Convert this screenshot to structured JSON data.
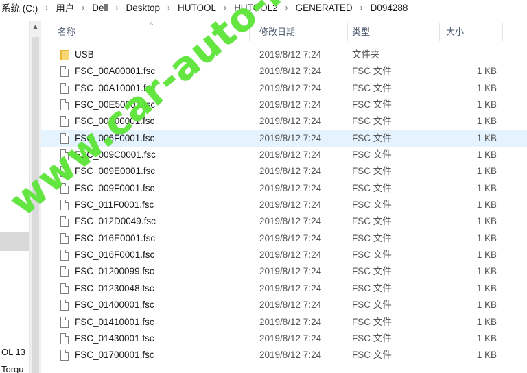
{
  "breadcrumb": {
    "items": [
      "系统 (C:)",
      "用户",
      "Dell",
      "Desktop",
      "HUTOOL",
      "HUTOOL2",
      "GENERATED",
      "D094288"
    ],
    "separator": "›"
  },
  "nav_pane": {
    "items": [
      {
        "label": "OL 13"
      },
      {
        "label": "Torqu"
      }
    ]
  },
  "columns": {
    "name": "名称",
    "date": "修改日期",
    "type": "类型",
    "size": "大小",
    "sort_indicator": "^"
  },
  "files": [
    {
      "name": "USB",
      "date": "2019/8/12 7:24",
      "type": "文件夹",
      "size": "",
      "icon": "folder-icon",
      "selected": false
    },
    {
      "name": "FSC_00A00001.fsc",
      "date": "2019/8/12 7:24",
      "type": "FSC 文件",
      "size": "1 KB",
      "icon": "file-icon",
      "selected": false
    },
    {
      "name": "FSC_00A10001.fsc",
      "date": "2019/8/12 7:24",
      "type": "FSC 文件",
      "size": "1 KB",
      "icon": "file-icon",
      "selected": false
    },
    {
      "name": "FSC_00E50001.fsc",
      "date": "2019/8/12 7:24",
      "type": "FSC 文件",
      "size": "1 KB",
      "icon": "file-icon",
      "selected": false
    },
    {
      "name": "FSC_00F00001.fsc",
      "date": "2019/8/12 7:24",
      "type": "FSC 文件",
      "size": "1 KB",
      "icon": "file-icon",
      "selected": false
    },
    {
      "name": "FSC_006F0001.fsc",
      "date": "2019/8/12 7:24",
      "type": "FSC 文件",
      "size": "1 KB",
      "icon": "file-icon",
      "selected": true
    },
    {
      "name": "FSC_009C0001.fsc",
      "date": "2019/8/12 7:24",
      "type": "FSC 文件",
      "size": "1 KB",
      "icon": "file-icon",
      "selected": false
    },
    {
      "name": "FSC_009E0001.fsc",
      "date": "2019/8/12 7:24",
      "type": "FSC 文件",
      "size": "1 KB",
      "icon": "file-icon",
      "selected": false
    },
    {
      "name": "FSC_009F0001.fsc",
      "date": "2019/8/12 7:24",
      "type": "FSC 文件",
      "size": "1 KB",
      "icon": "file-icon",
      "selected": false
    },
    {
      "name": "FSC_011F0001.fsc",
      "date": "2019/8/12 7:24",
      "type": "FSC 文件",
      "size": "1 KB",
      "icon": "file-icon",
      "selected": false
    },
    {
      "name": "FSC_012D0049.fsc",
      "date": "2019/8/12 7:24",
      "type": "FSC 文件",
      "size": "1 KB",
      "icon": "file-icon",
      "selected": false
    },
    {
      "name": "FSC_016E0001.fsc",
      "date": "2019/8/12 7:24",
      "type": "FSC 文件",
      "size": "1 KB",
      "icon": "file-icon",
      "selected": false
    },
    {
      "name": "FSC_016F0001.fsc",
      "date": "2019/8/12 7:24",
      "type": "FSC 文件",
      "size": "1 KB",
      "icon": "file-icon",
      "selected": false
    },
    {
      "name": "FSC_01200099.fsc",
      "date": "2019/8/12 7:24",
      "type": "FSC 文件",
      "size": "1 KB",
      "icon": "file-icon",
      "selected": false
    },
    {
      "name": "FSC_01230048.fsc",
      "date": "2019/8/12 7:24",
      "type": "FSC 文件",
      "size": "1 KB",
      "icon": "file-icon",
      "selected": false
    },
    {
      "name": "FSC_01400001.fsc",
      "date": "2019/8/12 7:24",
      "type": "FSC 文件",
      "size": "1 KB",
      "icon": "file-icon",
      "selected": false
    },
    {
      "name": "FSC_01410001.fsc",
      "date": "2019/8/12 7:24",
      "type": "FSC 文件",
      "size": "1 KB",
      "icon": "file-icon",
      "selected": false
    },
    {
      "name": "FSC_01430001.fsc",
      "date": "2019/8/12 7:24",
      "type": "FSC 文件",
      "size": "1 KB",
      "icon": "file-icon",
      "selected": false
    },
    {
      "name": "FSC_01700001.fsc",
      "date": "2019/8/12 7:24",
      "type": "FSC 文件",
      "size": "1 KB",
      "icon": "file-icon",
      "selected": false
    }
  ],
  "watermark": {
    "text": "www.car-auto-repair.com",
    "color": "#5ee63a"
  },
  "colors": {
    "selected_row": "#e5f3ff",
    "nav_selected": "#d9d9d9",
    "folder": "#f8d774",
    "header_text": "#4d5a6e"
  }
}
